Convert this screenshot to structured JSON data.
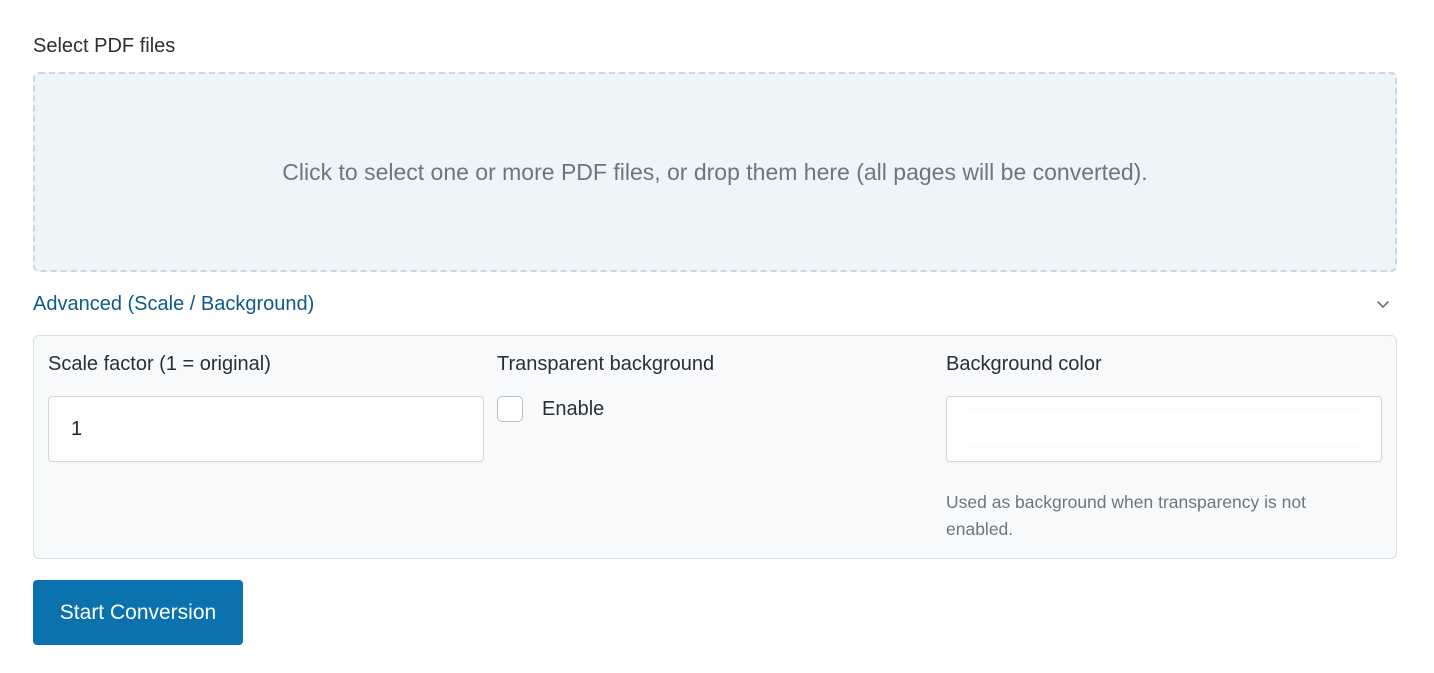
{
  "upload": {
    "label": "Select PDF files",
    "dropzone_text": "Click to select one or more PDF files, or drop them here (all pages will be converted)."
  },
  "advanced": {
    "title": "Advanced (Scale / Background)",
    "expanded": true,
    "toggle_icon": "chevron-down-icon",
    "scale": {
      "label": "Scale factor (1 = original)",
      "value": "1"
    },
    "transparent": {
      "label": "Transparent background",
      "checkbox_label": "Enable",
      "checked": false
    },
    "background": {
      "label": "Background color",
      "value": "#ffffff",
      "help": "Used as background when transparency is not enabled."
    }
  },
  "actions": {
    "start_label": "Start Conversion"
  },
  "colors": {
    "accent": "#0b72ad",
    "link": "#0b5b8a",
    "dropzone_bg": "#eef5f8",
    "panel_bg": "#f8f9fa"
  }
}
